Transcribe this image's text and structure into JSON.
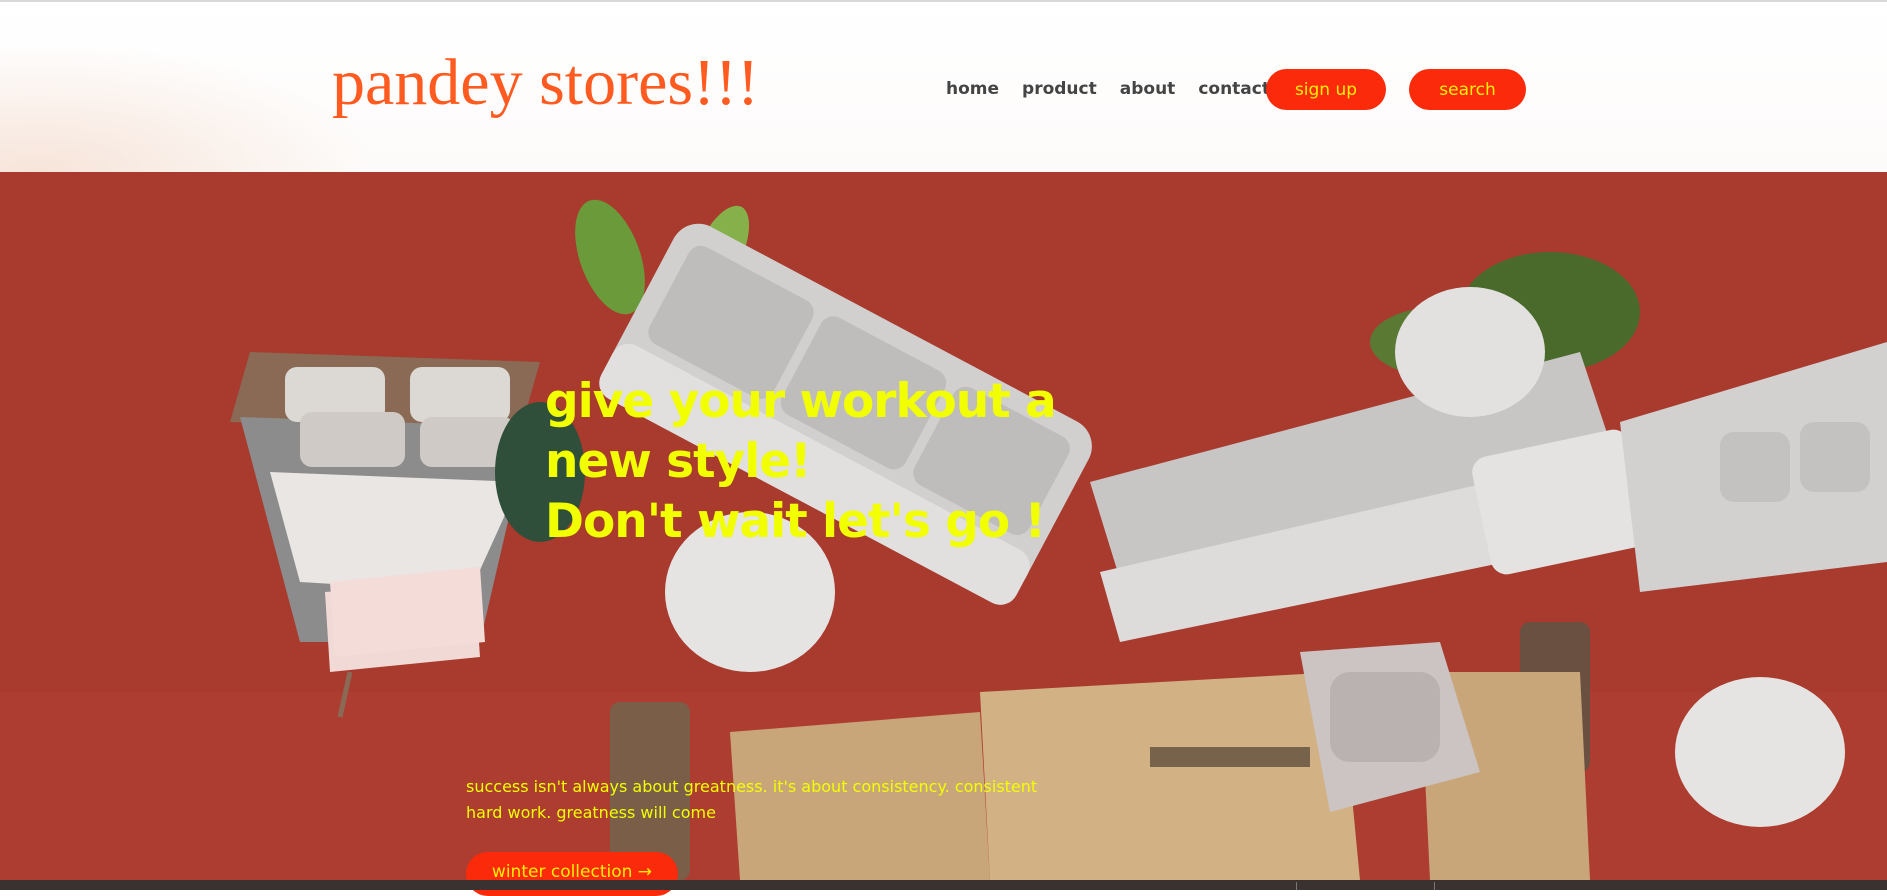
{
  "header": {
    "logo": "pandey stores!!!",
    "nav": [
      {
        "label": "home"
      },
      {
        "label": "product"
      },
      {
        "label": "about"
      },
      {
        "label": "contact"
      }
    ],
    "signup_label": "sign up",
    "search_label": "search"
  },
  "hero": {
    "headline_line1": "give your workout a",
    "headline_line2": "new style!",
    "headline_line3": "Don't wait let's go !",
    "tagline": "success isn't always about greatness. it's about consistency. consistent hard work. greatness will come",
    "cta_label": "winter collection →"
  },
  "colors": {
    "logo": "#ff5a1f",
    "button_bg": "#fa2a0a",
    "button_text": "#ffee00",
    "hero_bg": "#a83a2e",
    "headline": "#f2ff00"
  }
}
